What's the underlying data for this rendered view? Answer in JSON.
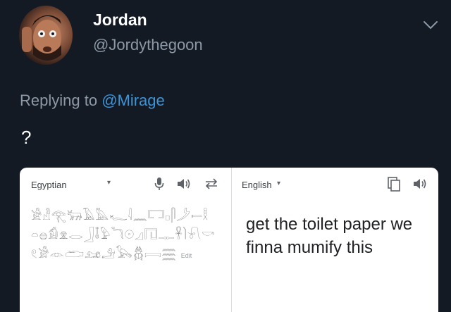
{
  "tweet": {
    "display_name": "Jordan",
    "handle": "@Jordythegoon",
    "replying_prefix": "Replying to ",
    "replying_to": "@Mirage",
    "text": "?"
  },
  "translate_card": {
    "source_language": "Egyptian",
    "target_language": "English",
    "source_text": "𓀀𓁐𓂀𓃒𓄿𓅓𓆑𓇋𓈖𓉐𓊪𓋴𓌳𓍿𓎛𓏏𓐍𓀁𓁷𓂋𓃀𓄤𓅱𓆓𓇳𓈎𓉔𓊃𓋹𓌙𓍯𓎡𓏲𓀂𓁹𓂧𓃭𓄂𓅂𓆣𓇯𓈗",
    "edit_label": "Edit",
    "translated_text": "get the toilet paper we finna mumify this"
  },
  "icons": {
    "chevron": "chevron-down-icon",
    "mic": "microphone-icon",
    "speaker": "speaker-icon",
    "swap": "swap-languages-icon",
    "copy": "copy-icon"
  },
  "colors": {
    "background": "#141a24",
    "secondary_text": "#8d99a6",
    "link": "#3b94d9",
    "card": "#ffffff"
  }
}
